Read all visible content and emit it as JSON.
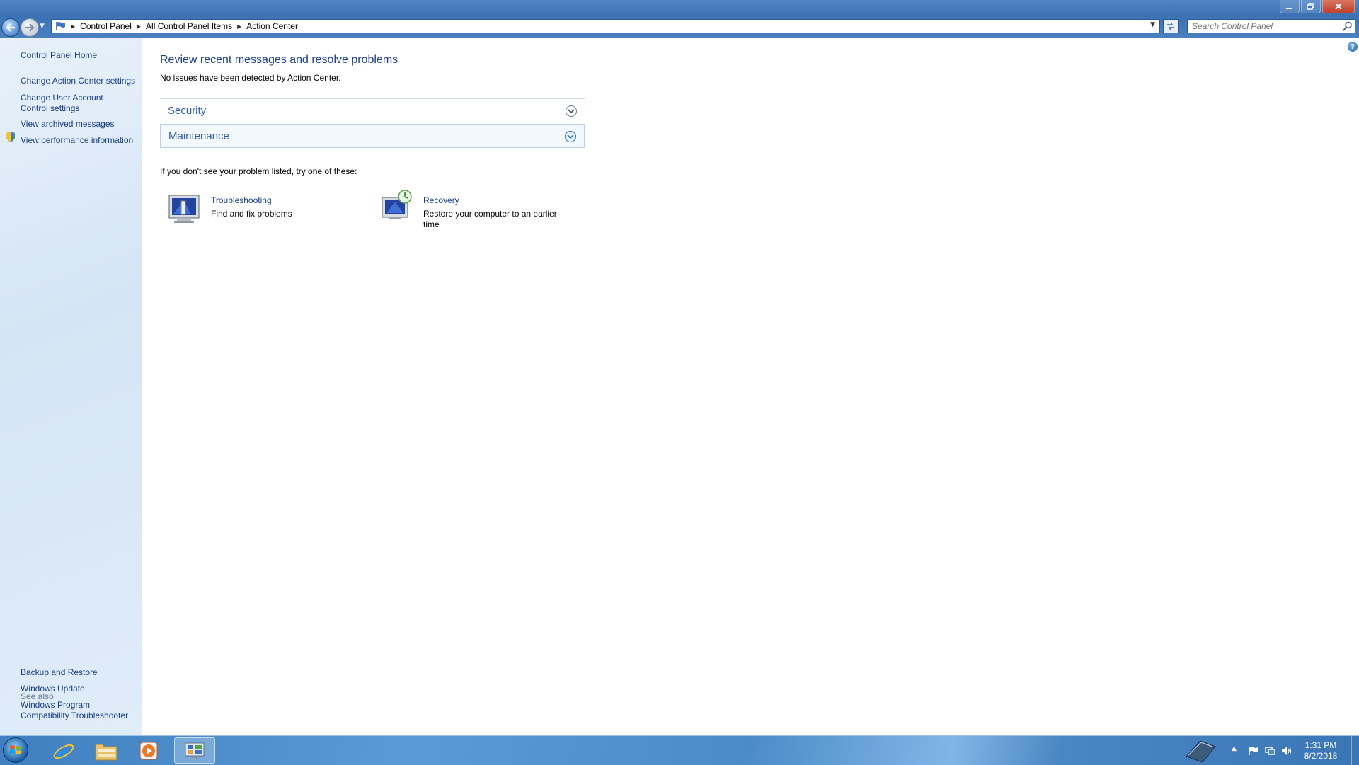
{
  "window": {
    "controls": [
      "minimize",
      "maximize",
      "close"
    ]
  },
  "navbar": {
    "breadcrumbs": [
      "Control Panel",
      "All Control Panel Items",
      "Action Center"
    ],
    "search_placeholder": "Search Control Panel"
  },
  "sidebar": {
    "links": [
      "Control Panel Home",
      "Change Action Center settings",
      "Change User Account Control settings",
      "View archived messages",
      "View performance information"
    ],
    "see_also_label": "See also",
    "see_also": [
      "Backup and Restore",
      "Windows Update",
      "Windows Program Compatibility Troubleshooter"
    ]
  },
  "main": {
    "title": "Review recent messages and resolve problems",
    "subtitle": "No issues have been detected by Action Center.",
    "sections": [
      "Security",
      "Maintenance"
    ],
    "try_text": "If you don't see your problem listed, try one of these:",
    "tools": [
      {
        "name": "Troubleshooting",
        "description": "Find and fix problems",
        "icon": "troubleshooting-icon"
      },
      {
        "name": "Recovery",
        "description": "Restore your computer to an earlier time",
        "icon": "recovery-icon"
      }
    ]
  },
  "taskbar": {
    "pinned": [
      "internet-explorer-icon",
      "windows-explorer-icon",
      "media-player-icon",
      "control-panel-icon"
    ],
    "tray_icons": [
      "show-hidden-icons-arrow",
      "action-center-flag-icon",
      "network-icon",
      "volume-icon"
    ],
    "time": "1:31 PM",
    "date": "8/2/2018"
  },
  "colors": {
    "link": "#1a3f88",
    "title": "#1e3f8a",
    "section_title": "#2e5ea8",
    "sidebar_bg": "#dbe8f6",
    "taskbar": "#4b8bc8"
  }
}
